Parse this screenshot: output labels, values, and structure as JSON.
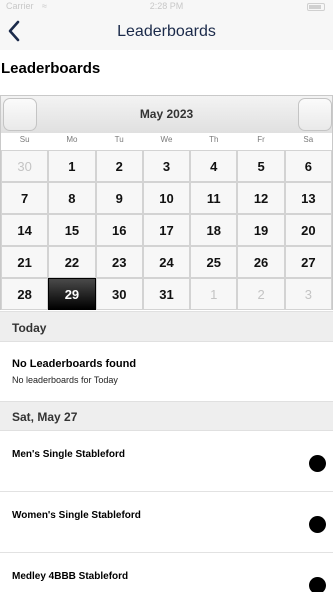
{
  "status_bar": {
    "carrier": "Carrier",
    "time": "2:28 PM"
  },
  "nav": {
    "title": "Leaderboards"
  },
  "page": {
    "heading": "Leaderboards"
  },
  "calendar": {
    "month_label": "May 2023",
    "weekdays": [
      "Su",
      "Mo",
      "Tu",
      "We",
      "Th",
      "Fr",
      "Sa"
    ],
    "days": [
      {
        "label": "30",
        "muted": true
      },
      {
        "label": "1"
      },
      {
        "label": "2"
      },
      {
        "label": "3"
      },
      {
        "label": "4"
      },
      {
        "label": "5"
      },
      {
        "label": "6"
      },
      {
        "label": "7"
      },
      {
        "label": "8"
      },
      {
        "label": "9"
      },
      {
        "label": "10"
      },
      {
        "label": "11"
      },
      {
        "label": "12"
      },
      {
        "label": "13"
      },
      {
        "label": "14"
      },
      {
        "label": "15"
      },
      {
        "label": "16"
      },
      {
        "label": "17"
      },
      {
        "label": "18"
      },
      {
        "label": "19"
      },
      {
        "label": "20"
      },
      {
        "label": "21"
      },
      {
        "label": "22"
      },
      {
        "label": "23"
      },
      {
        "label": "24"
      },
      {
        "label": "25"
      },
      {
        "label": "26"
      },
      {
        "label": "27"
      },
      {
        "label": "28"
      },
      {
        "label": "29",
        "selected": true
      },
      {
        "label": "30"
      },
      {
        "label": "31"
      },
      {
        "label": "1",
        "muted": true
      },
      {
        "label": "2",
        "muted": true
      },
      {
        "label": "3",
        "muted": true
      }
    ]
  },
  "today_section": {
    "header": "Today",
    "empty_title": "No Leaderboards found",
    "empty_subtitle": "No leaderboards for Today"
  },
  "date_section": {
    "header": "Sat, May 27",
    "items": [
      {
        "label": "Men's Single Stableford"
      },
      {
        "label": "Women's Single Stableford"
      },
      {
        "label": "Medley 4BBB Stableford"
      }
    ]
  }
}
